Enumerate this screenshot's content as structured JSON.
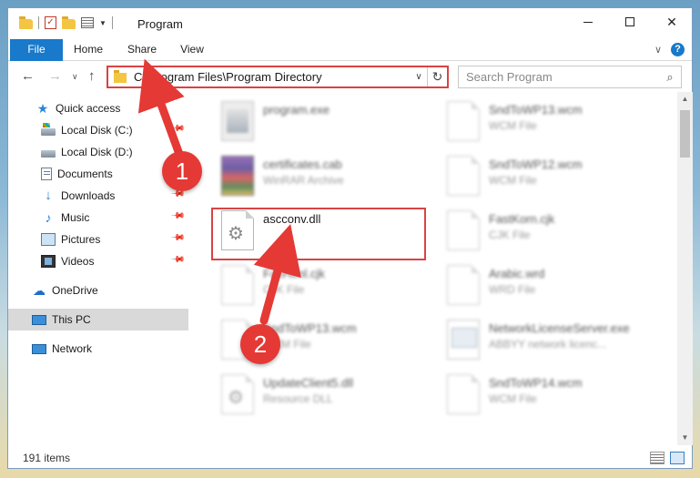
{
  "window": {
    "title": "Program"
  },
  "ribbon": {
    "tabs": [
      "File",
      "Home",
      "Share",
      "View"
    ]
  },
  "address_bar": {
    "path": "C:\\Program Files\\Program Directory"
  },
  "search": {
    "placeholder": "Search Program"
  },
  "sidebar": {
    "items": [
      {
        "label": "Quick access",
        "icon": "star-icon"
      },
      {
        "label": "Local Disk (C:)",
        "icon": "drive-icon",
        "pinned": true
      },
      {
        "label": "Local Disk (D:)",
        "icon": "drive-icon"
      },
      {
        "label": "Documents",
        "icon": "documents-icon",
        "pinned": true
      },
      {
        "label": "Downloads",
        "icon": "download-icon",
        "pinned": true
      },
      {
        "label": "Music",
        "icon": "music-icon",
        "pinned": true
      },
      {
        "label": "Pictures",
        "icon": "pictures-icon",
        "pinned": true
      },
      {
        "label": "Videos",
        "icon": "videos-icon",
        "pinned": true
      },
      {
        "label": "OneDrive",
        "icon": "cloud-icon"
      },
      {
        "label": "This PC",
        "icon": "computer-icon",
        "selected": true
      },
      {
        "label": "Network",
        "icon": "network-icon"
      }
    ]
  },
  "files": {
    "left": [
      {
        "name": "program.exe",
        "type": ""
      },
      {
        "name": "certificates.cab",
        "type": "WinRAR Archive"
      },
      {
        "name": "ascconv.dll",
        "type": ""
      },
      {
        "name": "FaxHtml.cjk",
        "type": "CJK File"
      },
      {
        "name": "SndToWP13.wcm",
        "type": "WCM File"
      },
      {
        "name": "UpdateClient5.dll",
        "type": "Resource DLL"
      }
    ],
    "right": [
      {
        "name": "SndToWP13.wcm",
        "type": "WCM File"
      },
      {
        "name": "SndToWP12.wcm",
        "type": "WCM File"
      },
      {
        "name": "FastKorn.cjk",
        "type": "CJK File"
      },
      {
        "name": "Arabic.wrd",
        "type": "WRD File"
      },
      {
        "name": "NetworkLicenseServer.exe",
        "type": "ABBYY network licenc..."
      },
      {
        "name": "SndToWP14.wcm",
        "type": "WCM File"
      }
    ]
  },
  "status": {
    "item_count": "191 items"
  },
  "annotations": {
    "step1": "1",
    "step2": "2",
    "color": "#e53935"
  }
}
